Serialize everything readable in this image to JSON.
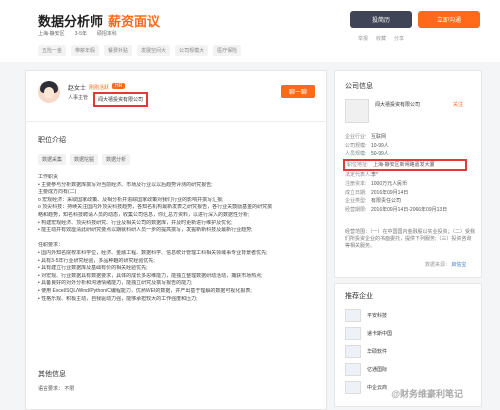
{
  "job": {
    "title": "数据分析师",
    "salary": "薪资面议",
    "meta": [
      "上海-静安区",
      "3-5年",
      "硕招本科"
    ],
    "benefits": [
      "五险一金",
      "带薪年假",
      "餐费补贴",
      "发展空间大",
      "公司规模大",
      "医疗保险"
    ]
  },
  "header_actions": {
    "resume": "投简历",
    "chat": "立即沟通",
    "links": [
      "举报",
      "收藏",
      "分享"
    ]
  },
  "recruiter": {
    "name": "赵女士",
    "online": "刚刚活跃",
    "badge": "HR",
    "role": "人事主管",
    "company": "闻大禧投资有限公司",
    "chat": "聊一聊"
  },
  "job_intro": {
    "title": "职位介绍",
    "keywords": [
      "数据采集",
      "数据挖掘",
      "数据分析"
    ],
    "lines": [
      "工作职责",
      "• 主要参与分析数据库撰写对当前经济、市场及行业以以后趋势评测的研究报告;",
      "主要成方向有(二)",
      "o 宏观经济：采取国家政策、及相分析并追踪国家政策对我们行业的影响并撰写汇报;",
      "o 顶尖科技：持续关注国内外顶尖科技趋势，各知名机构最新发表之研究报告，各行业关鼓励基金的研究撰",
      "略和趋势，知名科技聘请人员的动态，收集公司信息，你汇总方资料，以进行深入的数据性分析;",
      "• 构建宏观经济、顶尖科技研究、行业及相关公司的数据库，并及时更新进行维护及优化;",
      "• 能主动并有效厘清此研研究要点以期就科研人员一步的提高撰写，发掘新新科技及最新行业趋势;",
      "",
      "任职要求：",
      "• 国内外知名院校本科学位，经济、金融工程、数据科学、信息统计管理工科相关领域事专业背景者优先;",
      "• 具有3-5年行业研究经验，多品种趣的研究经验优先;",
      "• 具有建立行业数据库及基础有价的相关经验优先;",
      "• 对宏观、行业数据具有数据要求，具体的成长多思维能力，能独立整理数据研动活动，捕获市场热点;",
      "• 具备良好的对外分析和沟通情绪能力，能独立研究及撰写报告的能力;",
      "• 使用 Excel/SQL/Wind/Python/C编程能力，优熟WEI的数据，并产出基于理解的数据可视化报表;",
      "• 性格乐观、积极主动，自我驱动力强，能够承担较大的工作强度和压力;"
    ]
  },
  "other_info": {
    "title": "其他信息",
    "label": "语言要求：",
    "value": "不限"
  },
  "company": {
    "title": "公司信息",
    "name": "闻大禧投资有限公司",
    "follow": "关注",
    "rows": [
      {
        "k": "企业行业:",
        "v": "互联网"
      },
      {
        "k": "公司规模:",
        "v": "10-99人"
      },
      {
        "k": "人员规模:",
        "v": "50-99人"
      },
      {
        "k": "职位地址:",
        "v": "上海-静安区新闸路嘉发大厦"
      },
      {
        "k": "法定代表人:",
        "v": "李*"
      },
      {
        "k": "注册资本:",
        "v": "1000万元人民币"
      },
      {
        "k": "成立日期:",
        "v": "2016年09月14日"
      },
      {
        "k": "企业类型:",
        "v": "有限责任公司"
      },
      {
        "k": "经营期限:",
        "v": "2016年09月14日-2066年09月13日"
      }
    ],
    "desc": "经营范围：（一）在中国国内金融股以实业投资；（二）受我们所投资企业的书面委托，提供下列服务;（三）投资咨询等相关服务。",
    "source": "数据来源：",
    "source_brand": "启信宝"
  },
  "recommend": {
    "title": "推荐企业",
    "items": [
      "平安科技",
      "递卡斯中国",
      "华硕软件",
      "亿通国际",
      "中企云商"
    ]
  },
  "watermark": "@财务维豪利笔记"
}
